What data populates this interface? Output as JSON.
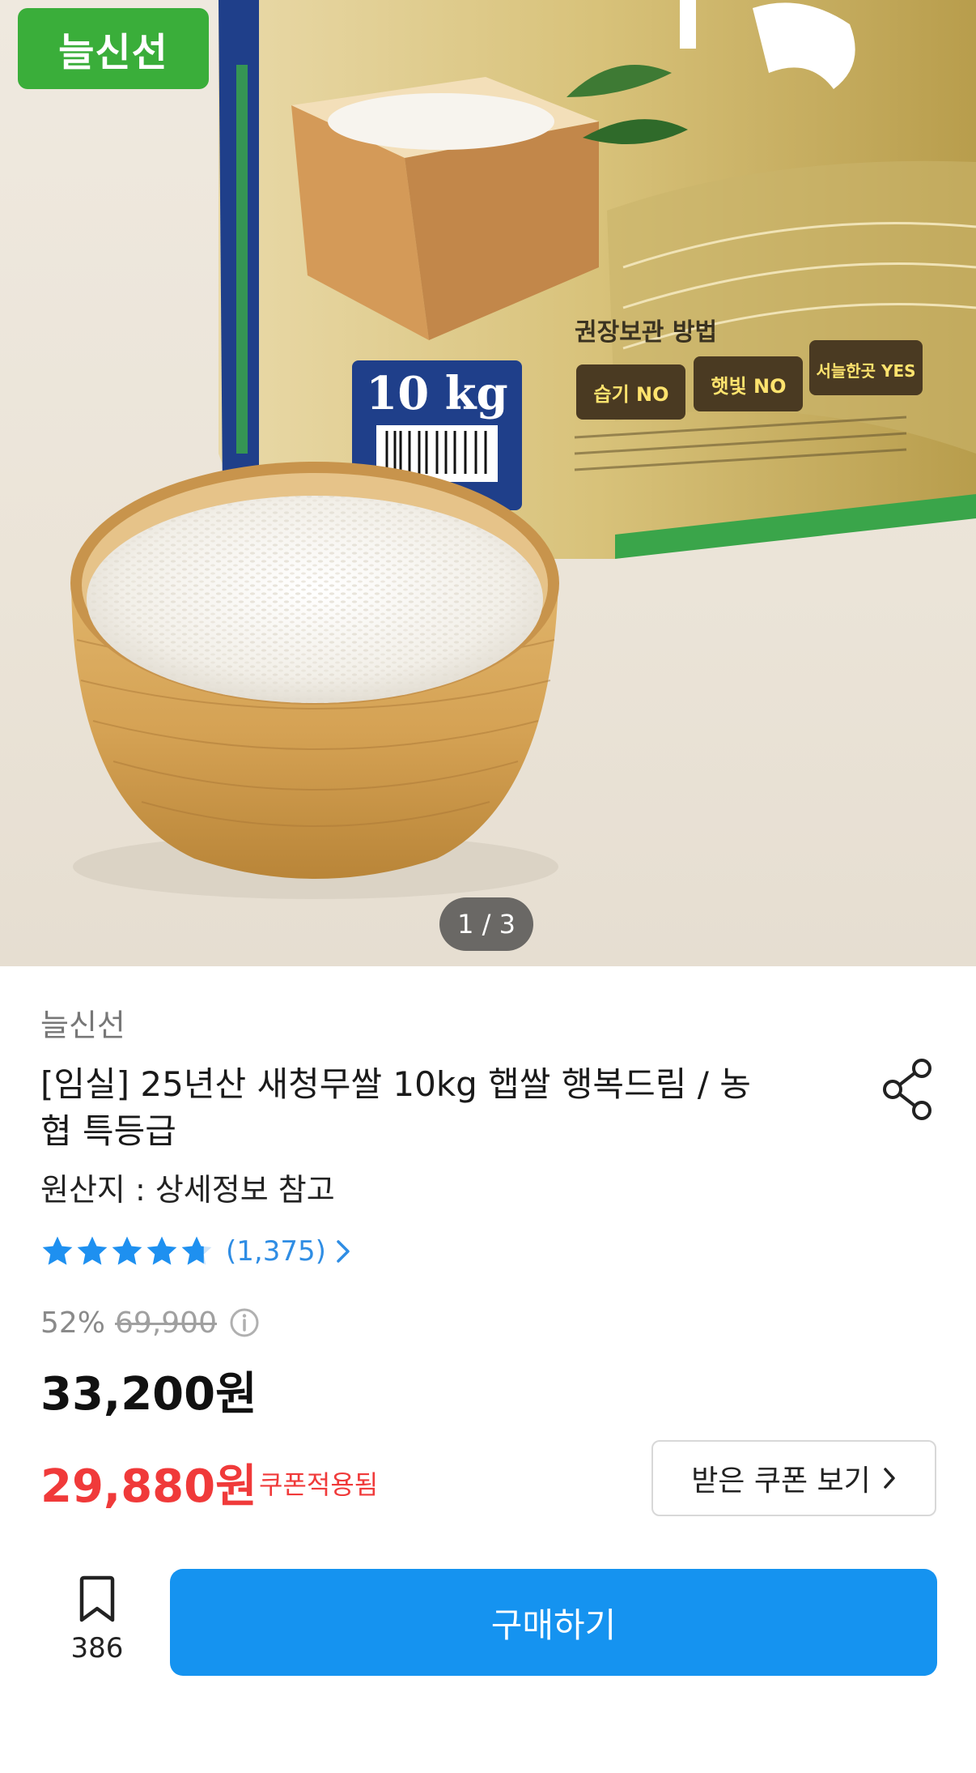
{
  "gallery": {
    "badge": "늘신선",
    "indicator": "1 / 3",
    "package_weight": "10 kg",
    "package_heading": "권장보관 방법",
    "package_tags": [
      "습기 NO",
      "햇빛 NO",
      "서늘한곳 YES"
    ]
  },
  "product": {
    "brand": "늘신선",
    "title": "[임실] 25년산 새청무쌀 10kg 햅쌀 행복드림 / 농협 특등급",
    "origin": "원산지 : 상세정보 참고",
    "rating": {
      "stars": 4.8,
      "max_stars": 5,
      "review_count": "(1,375)",
      "star_color": "#1e90f0"
    }
  },
  "pricing": {
    "discount_percent": "52%",
    "original_price": "69,900",
    "sale_price": "33,200원",
    "coupon_price": "29,880원",
    "coupon_applied_label": "쿠폰적용됨",
    "coupon_button_label": "받은 쿠폰 보기",
    "coupon_color": "#f03a3a"
  },
  "bottom_bar": {
    "save_count": "386",
    "buy_label": "구매하기",
    "buy_color": "#1593f0"
  },
  "icons": {
    "share": "share-icon",
    "info": "info-icon",
    "bookmark": "bookmark-icon",
    "chevron": "chevron-right-icon",
    "star": "star-icon"
  }
}
